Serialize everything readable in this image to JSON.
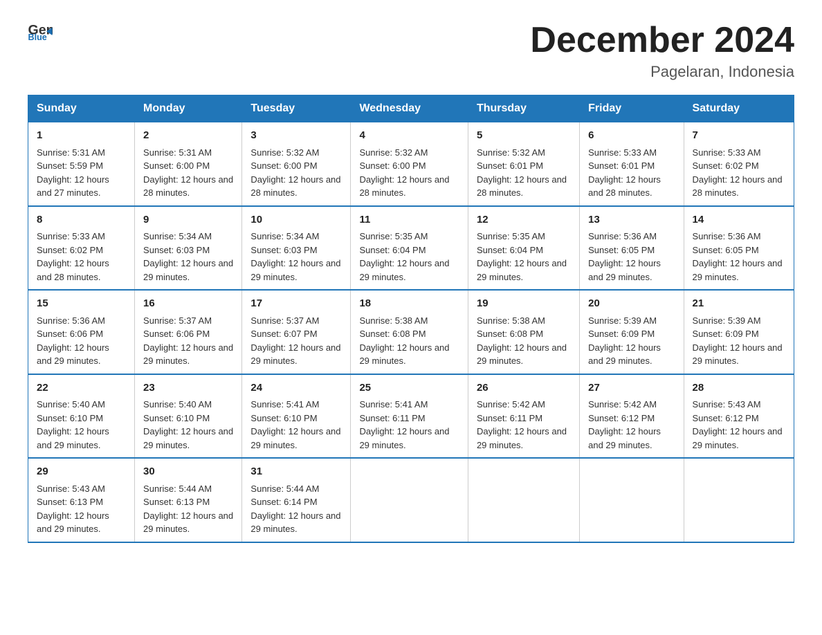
{
  "logo": {
    "general": "General",
    "triangle": "▶",
    "blue": "Blue"
  },
  "title": "December 2024",
  "subtitle": "Pagelaran, Indonesia",
  "headers": [
    "Sunday",
    "Monday",
    "Tuesday",
    "Wednesday",
    "Thursday",
    "Friday",
    "Saturday"
  ],
  "weeks": [
    [
      {
        "day": "1",
        "sunrise": "5:31 AM",
        "sunset": "5:59 PM",
        "daylight": "12 hours and 27 minutes."
      },
      {
        "day": "2",
        "sunrise": "5:31 AM",
        "sunset": "6:00 PM",
        "daylight": "12 hours and 28 minutes."
      },
      {
        "day": "3",
        "sunrise": "5:32 AM",
        "sunset": "6:00 PM",
        "daylight": "12 hours and 28 minutes."
      },
      {
        "day": "4",
        "sunrise": "5:32 AM",
        "sunset": "6:00 PM",
        "daylight": "12 hours and 28 minutes."
      },
      {
        "day": "5",
        "sunrise": "5:32 AM",
        "sunset": "6:01 PM",
        "daylight": "12 hours and 28 minutes."
      },
      {
        "day": "6",
        "sunrise": "5:33 AM",
        "sunset": "6:01 PM",
        "daylight": "12 hours and 28 minutes."
      },
      {
        "day": "7",
        "sunrise": "5:33 AM",
        "sunset": "6:02 PM",
        "daylight": "12 hours and 28 minutes."
      }
    ],
    [
      {
        "day": "8",
        "sunrise": "5:33 AM",
        "sunset": "6:02 PM",
        "daylight": "12 hours and 28 minutes."
      },
      {
        "day": "9",
        "sunrise": "5:34 AM",
        "sunset": "6:03 PM",
        "daylight": "12 hours and 29 minutes."
      },
      {
        "day": "10",
        "sunrise": "5:34 AM",
        "sunset": "6:03 PM",
        "daylight": "12 hours and 29 minutes."
      },
      {
        "day": "11",
        "sunrise": "5:35 AM",
        "sunset": "6:04 PM",
        "daylight": "12 hours and 29 minutes."
      },
      {
        "day": "12",
        "sunrise": "5:35 AM",
        "sunset": "6:04 PM",
        "daylight": "12 hours and 29 minutes."
      },
      {
        "day": "13",
        "sunrise": "5:36 AM",
        "sunset": "6:05 PM",
        "daylight": "12 hours and 29 minutes."
      },
      {
        "day": "14",
        "sunrise": "5:36 AM",
        "sunset": "6:05 PM",
        "daylight": "12 hours and 29 minutes."
      }
    ],
    [
      {
        "day": "15",
        "sunrise": "5:36 AM",
        "sunset": "6:06 PM",
        "daylight": "12 hours and 29 minutes."
      },
      {
        "day": "16",
        "sunrise": "5:37 AM",
        "sunset": "6:06 PM",
        "daylight": "12 hours and 29 minutes."
      },
      {
        "day": "17",
        "sunrise": "5:37 AM",
        "sunset": "6:07 PM",
        "daylight": "12 hours and 29 minutes."
      },
      {
        "day": "18",
        "sunrise": "5:38 AM",
        "sunset": "6:08 PM",
        "daylight": "12 hours and 29 minutes."
      },
      {
        "day": "19",
        "sunrise": "5:38 AM",
        "sunset": "6:08 PM",
        "daylight": "12 hours and 29 minutes."
      },
      {
        "day": "20",
        "sunrise": "5:39 AM",
        "sunset": "6:09 PM",
        "daylight": "12 hours and 29 minutes."
      },
      {
        "day": "21",
        "sunrise": "5:39 AM",
        "sunset": "6:09 PM",
        "daylight": "12 hours and 29 minutes."
      }
    ],
    [
      {
        "day": "22",
        "sunrise": "5:40 AM",
        "sunset": "6:10 PM",
        "daylight": "12 hours and 29 minutes."
      },
      {
        "day": "23",
        "sunrise": "5:40 AM",
        "sunset": "6:10 PM",
        "daylight": "12 hours and 29 minutes."
      },
      {
        "day": "24",
        "sunrise": "5:41 AM",
        "sunset": "6:10 PM",
        "daylight": "12 hours and 29 minutes."
      },
      {
        "day": "25",
        "sunrise": "5:41 AM",
        "sunset": "6:11 PM",
        "daylight": "12 hours and 29 minutes."
      },
      {
        "day": "26",
        "sunrise": "5:42 AM",
        "sunset": "6:11 PM",
        "daylight": "12 hours and 29 minutes."
      },
      {
        "day": "27",
        "sunrise": "5:42 AM",
        "sunset": "6:12 PM",
        "daylight": "12 hours and 29 minutes."
      },
      {
        "day": "28",
        "sunrise": "5:43 AM",
        "sunset": "6:12 PM",
        "daylight": "12 hours and 29 minutes."
      }
    ],
    [
      {
        "day": "29",
        "sunrise": "5:43 AM",
        "sunset": "6:13 PM",
        "daylight": "12 hours and 29 minutes."
      },
      {
        "day": "30",
        "sunrise": "5:44 AM",
        "sunset": "6:13 PM",
        "daylight": "12 hours and 29 minutes."
      },
      {
        "day": "31",
        "sunrise": "5:44 AM",
        "sunset": "6:14 PM",
        "daylight": "12 hours and 29 minutes."
      },
      null,
      null,
      null,
      null
    ]
  ]
}
